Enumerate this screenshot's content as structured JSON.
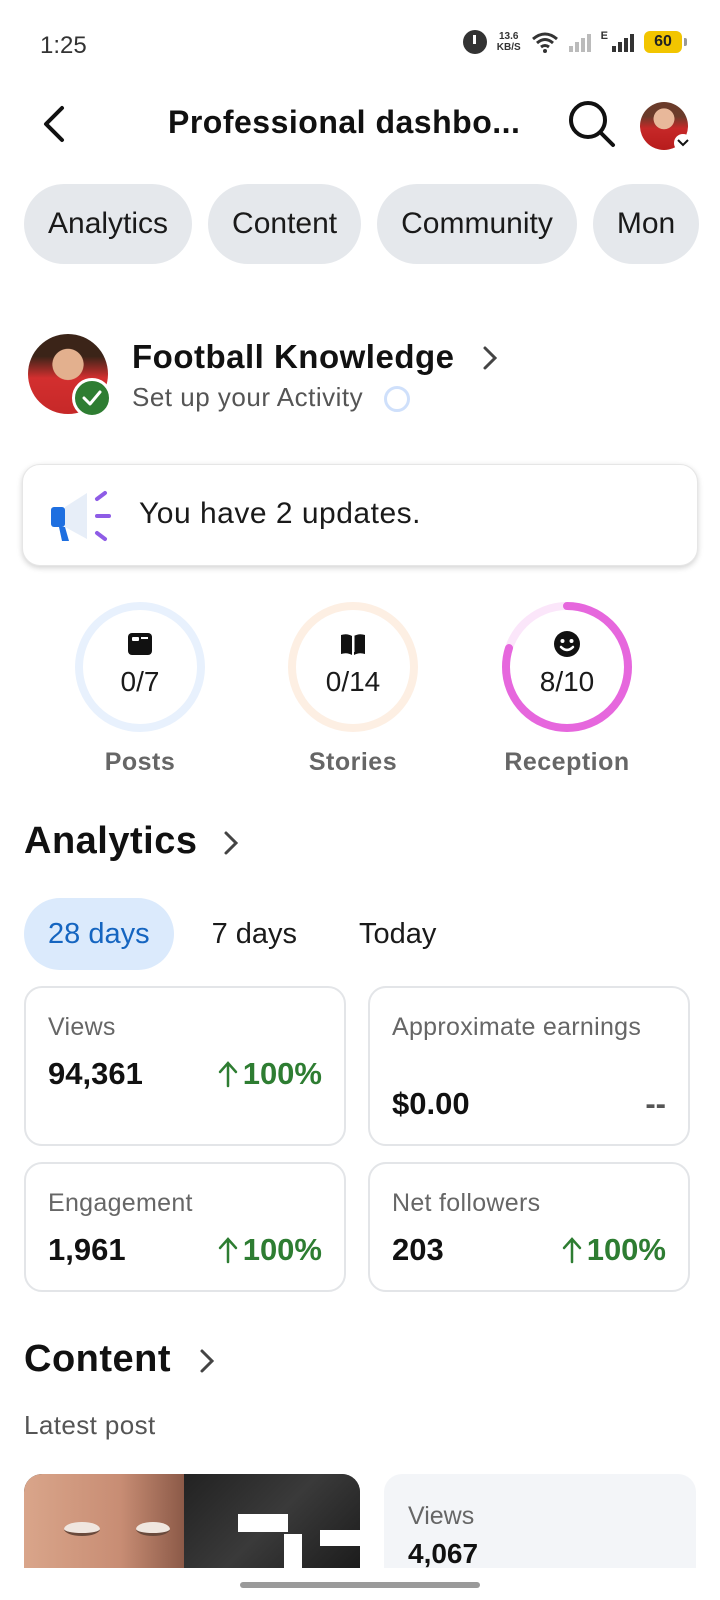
{
  "status_bar": {
    "time": "1:25",
    "speed_value": "13.6",
    "speed_unit": "KB/S",
    "network_type": "E",
    "battery": "60"
  },
  "header": {
    "title": "Professional dashbo...",
    "icons": [
      "back-arrow-icon",
      "search-icon",
      "avatar"
    ]
  },
  "tabs": [
    {
      "label": "Analytics"
    },
    {
      "label": "Content"
    },
    {
      "label": "Community"
    },
    {
      "label": "Mon"
    }
  ],
  "profile": {
    "name": "Football Knowledge",
    "subtitle": "Set up your Activity"
  },
  "updates": {
    "text": "You have 2 updates."
  },
  "stats": [
    {
      "value": "0/7",
      "label": "Posts",
      "progress": 0,
      "color": "#2f80ed",
      "track": "#e8f1fd",
      "icon": "post-icon"
    },
    {
      "value": "0/14",
      "label": "Stories",
      "progress": 0,
      "color": "#f2994a",
      "track": "#fdefe3",
      "icon": "book-icon"
    },
    {
      "value": "8/10",
      "label": "Reception",
      "progress": 0.8,
      "color": "#e667dd",
      "track": "#fbe6fa",
      "icon": "smiley-icon"
    }
  ],
  "analytics": {
    "title": "Analytics",
    "ranges": [
      {
        "label": "28 days",
        "active": true
      },
      {
        "label": "7 days",
        "active": false
      },
      {
        "label": "Today",
        "active": false
      }
    ],
    "metrics": [
      {
        "label": "Views",
        "value": "94,361",
        "change": "100%"
      },
      {
        "label": "Approximate earnings",
        "value": "$0.00",
        "change": "--"
      },
      {
        "label": "Engagement",
        "value": "1,961",
        "change": "100%"
      },
      {
        "label": "Net followers",
        "value": "203",
        "change": "100%"
      }
    ]
  },
  "content": {
    "title": "Content",
    "latest_label": "Latest post",
    "post_views_label": "Views",
    "post_views_value": "4,067"
  },
  "colors": {
    "accent_blue": "#1565c0",
    "positive_green": "#2e7d32",
    "chip_gray": "#e5e8ec"
  }
}
